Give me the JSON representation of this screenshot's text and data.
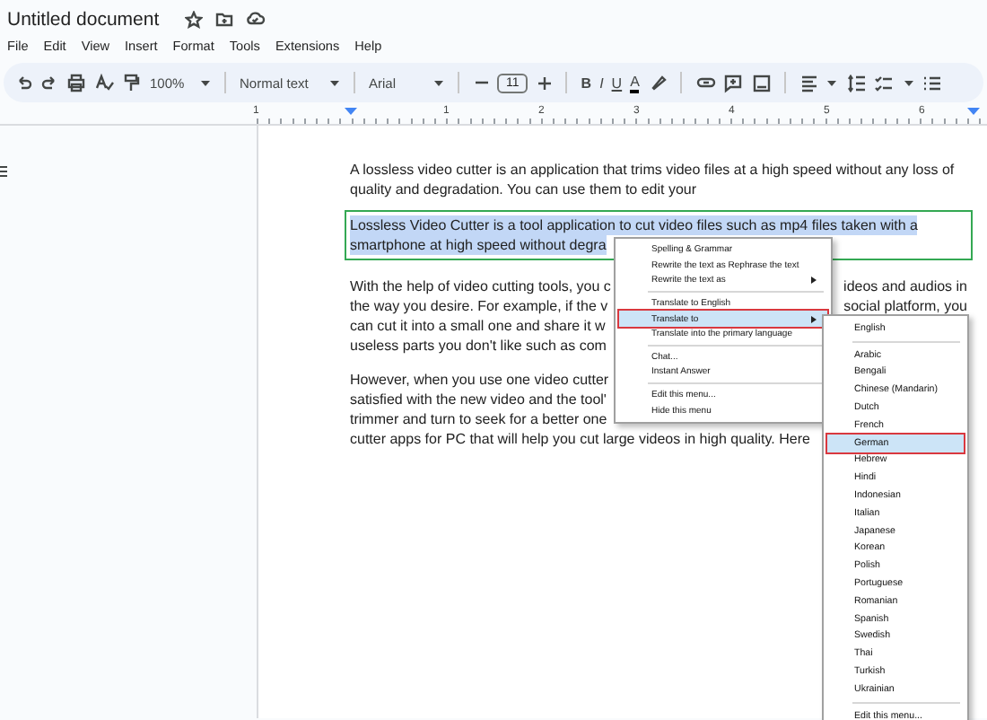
{
  "document_title": "Untitled document",
  "menu": [
    "File",
    "Edit",
    "View",
    "Insert",
    "Format",
    "Tools",
    "Extensions",
    "Help"
  ],
  "toolbar": {
    "zoom": "100%",
    "style": "Normal text",
    "font": "Arial",
    "font_size": "11",
    "bold": "B",
    "italic": "I",
    "underline": "U",
    "text_color": "A"
  },
  "ruler": [
    "1",
    "1",
    "2",
    "3",
    "4",
    "5",
    "6"
  ],
  "paragraphs": [
    {
      "selected": false,
      "boxed": false,
      "lines": [
        {
          "left": "A lossless video cutter is an application that trims video files at a high speed without any loss of"
        },
        {
          "left": "quality and degradation. You can use them to edit your"
        }
      ]
    },
    {
      "selected": true,
      "boxed": true,
      "lines": [
        {
          "left": "Lossless Video Cutter is a tool application to cut video files such as mp4 files taken with a"
        },
        {
          "left": "smartphone at high speed without degra"
        }
      ]
    },
    {
      "selected": false,
      "boxed": false,
      "lines": [
        {
          "left": "With the help of video cutting tools, you c",
          "right": "ideos and audios in"
        },
        {
          "left": "the way you desire. For example, if the v",
          "right": "social platform, you"
        },
        {
          "left": "can cut it into a small one and share it w"
        },
        {
          "left": "useless parts you don't like such as com"
        }
      ]
    },
    {
      "selected": false,
      "boxed": false,
      "lines": [
        {
          "left": "However, when you use one video cutter"
        },
        {
          "left": "satisfied with the new video and the tool'"
        },
        {
          "left": "trimmer and turn to seek for a better one"
        },
        {
          "left": "cutter apps for PC that will help you cut large videos in high quality. Here"
        }
      ]
    }
  ],
  "context_menu": [
    {
      "kind": "item",
      "label": "Spelling & Grammar",
      "submenu": false,
      "selected": false,
      "boxed": false
    },
    {
      "kind": "item",
      "label": "Rewrite the text as Rephrase the text",
      "submenu": false,
      "selected": false,
      "boxed": false
    },
    {
      "kind": "item",
      "label": "Rewrite the text as",
      "submenu": true,
      "selected": false,
      "boxed": false
    },
    {
      "kind": "separator"
    },
    {
      "kind": "item",
      "label": "Translate to English",
      "submenu": false,
      "selected": false,
      "boxed": false
    },
    {
      "kind": "item",
      "label": "Translate to",
      "submenu": true,
      "selected": true,
      "boxed": true
    },
    {
      "kind": "item",
      "label": "Translate into the primary language",
      "submenu": false,
      "selected": false,
      "boxed": false
    },
    {
      "kind": "separator"
    },
    {
      "kind": "item",
      "label": "Chat...",
      "submenu": false,
      "selected": false,
      "boxed": false
    },
    {
      "kind": "item",
      "label": "Instant Answer",
      "submenu": false,
      "selected": false,
      "boxed": false
    },
    {
      "kind": "separator"
    },
    {
      "kind": "item",
      "label": "Edit this menu...",
      "submenu": false,
      "selected": false,
      "boxed": false
    },
    {
      "kind": "item",
      "label": "Hide this menu",
      "submenu": false,
      "selected": false,
      "boxed": false
    }
  ],
  "translate_submenu": [
    {
      "kind": "item",
      "label": "English",
      "selected": false,
      "boxed": false
    },
    {
      "kind": "separator"
    },
    {
      "kind": "item",
      "label": "Arabic",
      "selected": false,
      "boxed": false
    },
    {
      "kind": "item",
      "label": "Bengali",
      "selected": false,
      "boxed": false
    },
    {
      "kind": "item",
      "label": "Chinese (Mandarin)",
      "selected": false,
      "boxed": false
    },
    {
      "kind": "item",
      "label": "Dutch",
      "selected": false,
      "boxed": false
    },
    {
      "kind": "item",
      "label": "French",
      "selected": false,
      "boxed": false
    },
    {
      "kind": "item",
      "label": "German",
      "selected": true,
      "boxed": true
    },
    {
      "kind": "item",
      "label": "Hebrew",
      "selected": false,
      "boxed": false
    },
    {
      "kind": "item",
      "label": "Hindi",
      "selected": false,
      "boxed": false
    },
    {
      "kind": "item",
      "label": "Indonesian",
      "selected": false,
      "boxed": false
    },
    {
      "kind": "item",
      "label": "Italian",
      "selected": false,
      "boxed": false
    },
    {
      "kind": "item",
      "label": "Japanese",
      "selected": false,
      "boxed": false
    },
    {
      "kind": "item",
      "label": "Korean",
      "selected": false,
      "boxed": false
    },
    {
      "kind": "item",
      "label": "Polish",
      "selected": false,
      "boxed": false
    },
    {
      "kind": "item",
      "label": "Portuguese",
      "selected": false,
      "boxed": false
    },
    {
      "kind": "item",
      "label": "Romanian",
      "selected": false,
      "boxed": false
    },
    {
      "kind": "item",
      "label": "Spanish",
      "selected": false,
      "boxed": false
    },
    {
      "kind": "item",
      "label": "Swedish",
      "selected": false,
      "boxed": false
    },
    {
      "kind": "item",
      "label": "Thai",
      "selected": false,
      "boxed": false
    },
    {
      "kind": "item",
      "label": "Turkish",
      "selected": false,
      "boxed": false
    },
    {
      "kind": "item",
      "label": "Ukrainian",
      "selected": false,
      "boxed": false
    },
    {
      "kind": "separator"
    },
    {
      "kind": "item",
      "label": "Edit this menu...",
      "selected": false,
      "boxed": false
    }
  ]
}
